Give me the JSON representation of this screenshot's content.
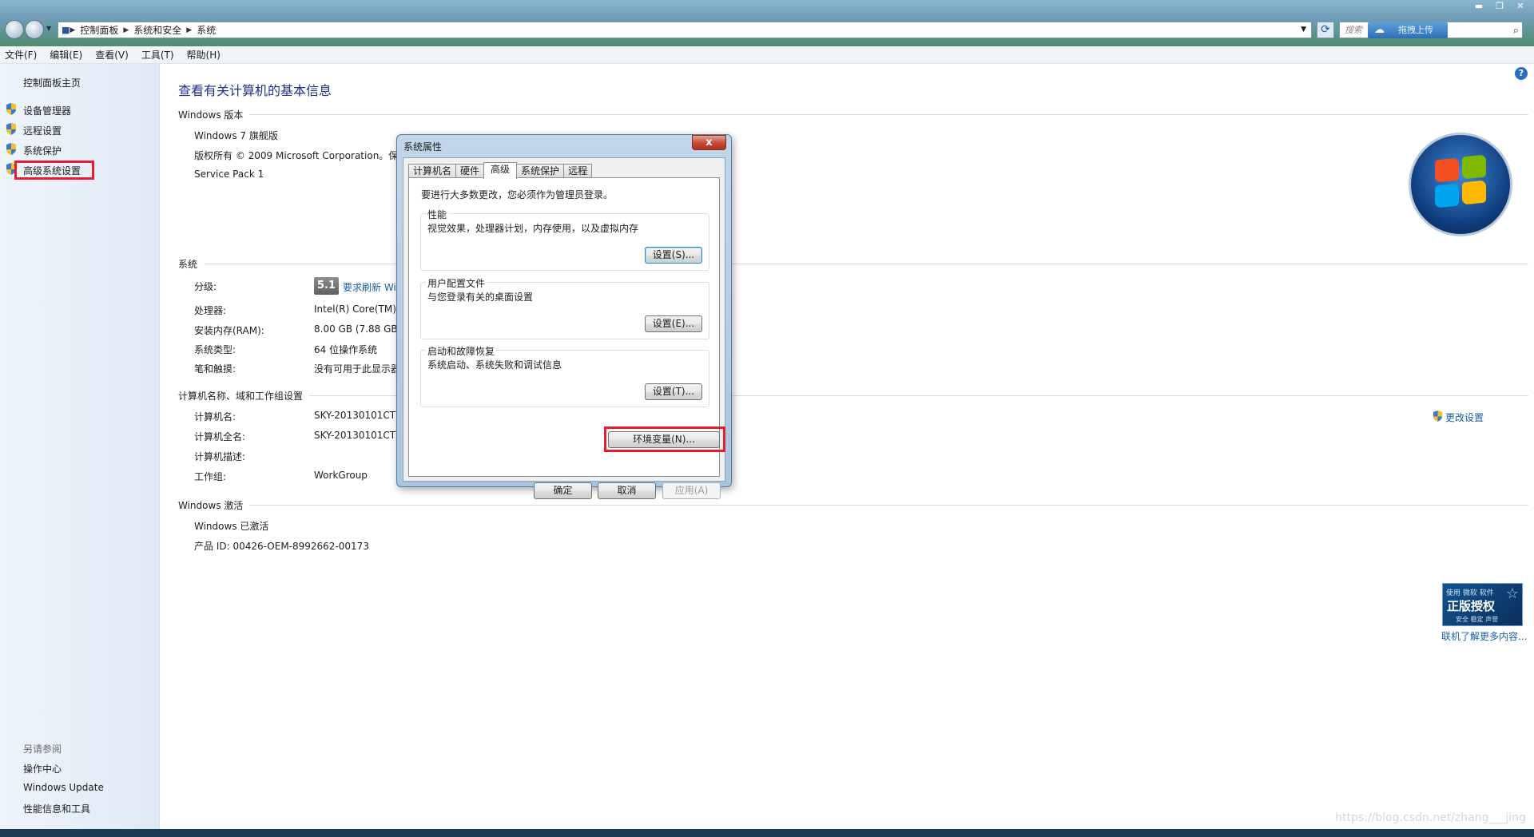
{
  "addressbar": {
    "crumbs": [
      "控制面板",
      "系统和安全",
      "系统"
    ],
    "search_placeholder": "搜索",
    "upload_label": "拖拽上传"
  },
  "menubar": {
    "items": [
      "文件(F)",
      "编辑(E)",
      "查看(V)",
      "工具(T)",
      "帮助(H)"
    ]
  },
  "sidebar": {
    "home": "控制面板主页",
    "items": [
      "设备管理器",
      "远程设置",
      "系统保护",
      "高级系统设置"
    ],
    "see_also_title": "另请参阅",
    "see_also": [
      "操作中心",
      "Windows Update",
      "性能信息和工具"
    ]
  },
  "main": {
    "title": "查看有关计算机的基本信息",
    "edition": {
      "heading": "Windows 版本",
      "name": "Windows 7 旗舰版",
      "copyright": "版权所有 © 2009 Microsoft Corporation。保",
      "service_pack": "Service Pack 1"
    },
    "system": {
      "heading": "系统",
      "rating_label": "分级:",
      "rating_value": "5.1",
      "rating_link": "要求刷新 Wi",
      "processor_label": "处理器:",
      "processor_value": "Intel(R) Core(TM)",
      "ram_label": "安装内存(RAM):",
      "ram_value": "8.00 GB (7.88 GB",
      "type_label": "系统类型:",
      "type_value": "64 位操作系统",
      "pen_label": "笔和触摸:",
      "pen_value": "没有可用于此显示器"
    },
    "computer": {
      "heading": "计算机名称、域和工作组设置",
      "name_label": "计算机名:",
      "name_value": "SKY-20130101CTU",
      "fullname_label": "计算机全名:",
      "fullname_value": "SKY-20130101CTU",
      "desc_label": "计算机描述:",
      "workgroup_label": "工作组:",
      "workgroup_value": "WorkGroup",
      "change_settings": "更改设置"
    },
    "activation": {
      "heading": "Windows 激活",
      "status": "Windows 已激活",
      "product_id": "产品 ID: 00426-OEM-8992662-00173",
      "genuine_top": "使用 微软 软件",
      "genuine_main": "正版授权",
      "genuine_bottom": "安全 稳定 声誉",
      "genuine_link": "联机了解更多内容..."
    }
  },
  "dialog": {
    "title": "系统属性",
    "close": "x",
    "tabs": [
      "计算机名",
      "硬件",
      "高级",
      "系统保护",
      "远程"
    ],
    "active_tab": "高级",
    "admin_note": "要进行大多数更改，您必须作为管理员登录。",
    "groups": [
      {
        "title": "性能",
        "desc": "视觉效果，处理器计划，内存使用，以及虚拟内存",
        "button": "设置(S)..."
      },
      {
        "title": "用户配置文件",
        "desc": "与您登录有关的桌面设置",
        "button": "设置(E)..."
      },
      {
        "title": "启动和故障恢复",
        "desc": "系统启动、系统失败和调试信息",
        "button": "设置(T)..."
      }
    ],
    "env_button": "环境变量(N)...",
    "ok": "确定",
    "cancel": "取消",
    "apply": "应用(A)"
  },
  "watermark": "https://blog.csdn.net/zhang___jing",
  "colors": {
    "link": "#1b5fa5",
    "title": "#1e3287",
    "highlight": "#e81c2c"
  }
}
